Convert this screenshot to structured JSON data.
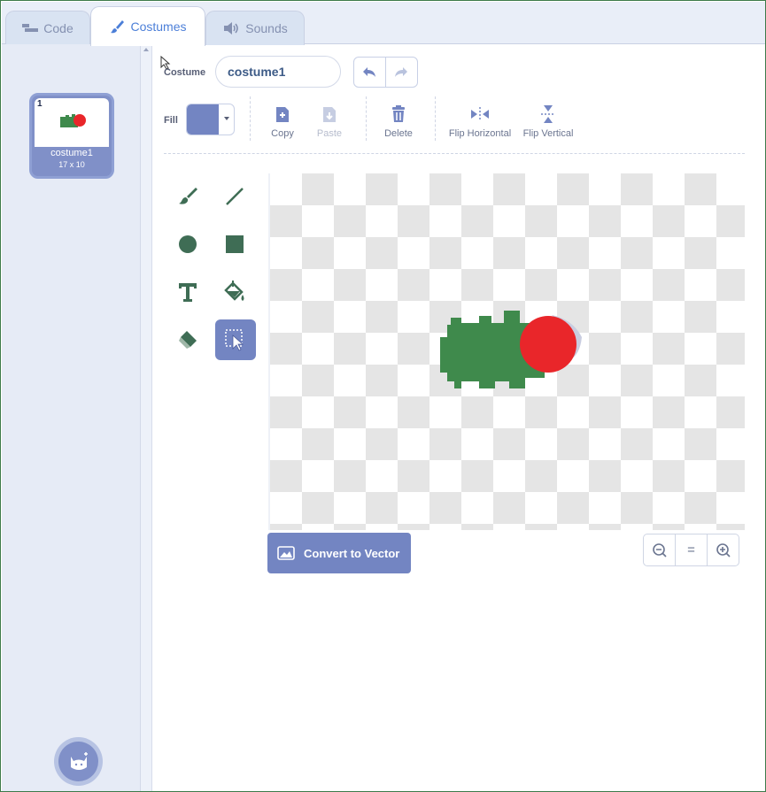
{
  "tabs": {
    "code": "Code",
    "costumes": "Costumes",
    "sounds": "Sounds"
  },
  "costume_list": {
    "items": [
      {
        "number": "1",
        "name": "costume1",
        "size": "17 x 10"
      }
    ],
    "choose_button_icon": "cat-plus-icon"
  },
  "editor": {
    "costume_label": "Costume",
    "costume_name": "costume1",
    "fill_label": "Fill",
    "fill_color": "#7385c2",
    "actions": {
      "copy": "Copy",
      "paste": "Paste",
      "delete": "Delete",
      "flip_horizontal": "Flip Horizontal",
      "flip_vertical": "Flip Vertical"
    },
    "tools": [
      "brush",
      "line",
      "circle",
      "rectangle",
      "text",
      "fill",
      "eraser",
      "select"
    ],
    "selected_tool": "select",
    "convert_button": "Convert to Vector",
    "zoom": {
      "out": "zoom-out-icon",
      "reset": "=",
      "in": "zoom-in-icon"
    }
  },
  "colors": {
    "accent": "#7385c2",
    "sprite_body": "#3f8a4c",
    "sprite_head": "#e9262a",
    "tab_active_text": "#4c7fd8"
  }
}
